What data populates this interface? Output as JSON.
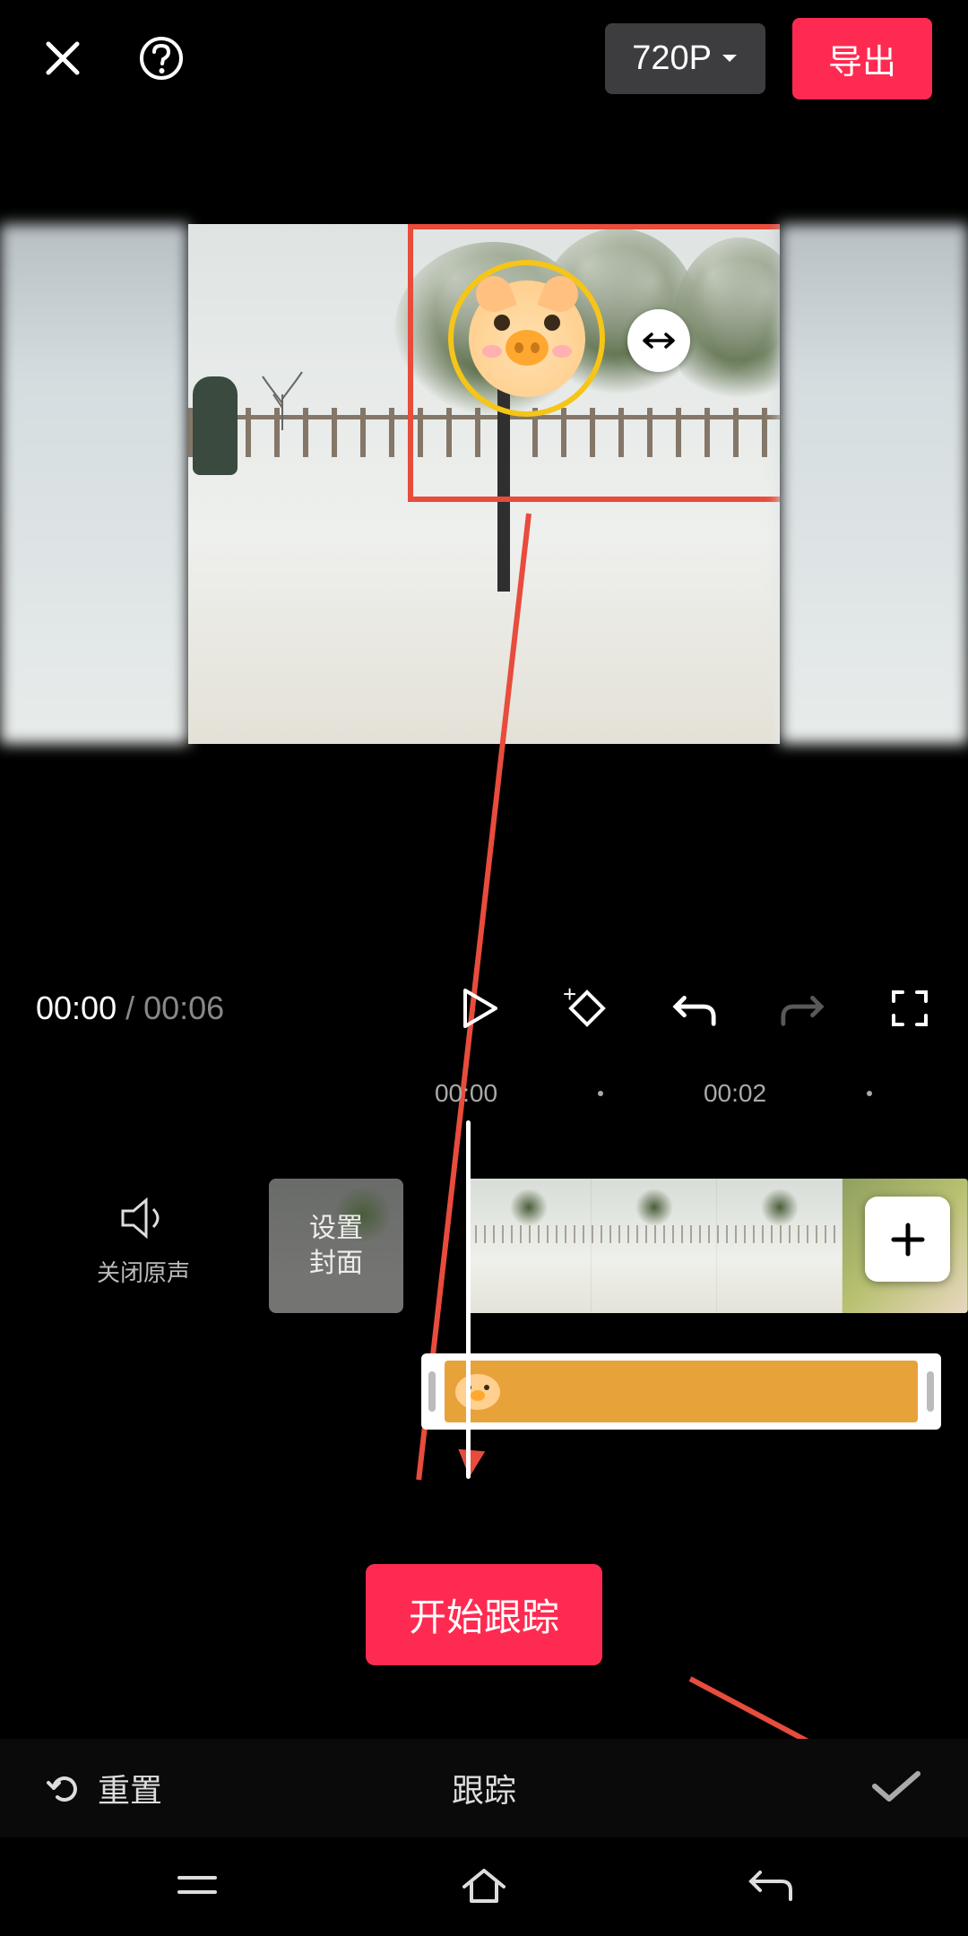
{
  "header": {
    "resolution": "720P",
    "export_label": "导出"
  },
  "preview": {
    "sticker_name": "pig-sticker"
  },
  "playback": {
    "current": "00:00",
    "separator": " / ",
    "duration": "00:06"
  },
  "ruler": {
    "marks": [
      "00:00",
      "00:02"
    ]
  },
  "timeline": {
    "audio_off_label": "关闭原声",
    "cover_label_line1": "设置",
    "cover_label_line2": "封面",
    "sticker_track_name": "pig-track"
  },
  "tracking": {
    "start_label": "开始跟踪"
  },
  "action_bar": {
    "reset_label": "重置",
    "panel_title": "跟踪"
  }
}
